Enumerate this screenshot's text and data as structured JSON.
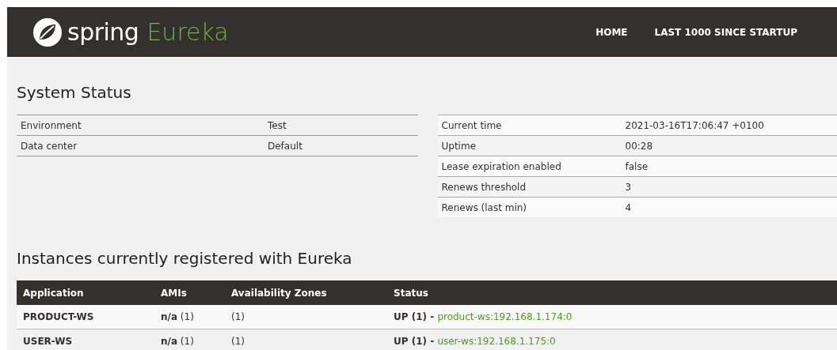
{
  "header": {
    "logo": {
      "brand": "spring",
      "product": "Eureka"
    },
    "nav": [
      "HOME",
      "LAST 1000 SINCE STARTUP"
    ]
  },
  "system_status": {
    "title": "System Status",
    "left_table": [
      {
        "label": "Environment",
        "value": "Test"
      },
      {
        "label": "Data center",
        "value": "Default"
      }
    ],
    "right_table": [
      {
        "label": "Current time",
        "value": "2021-03-16T17:06:47 +0100"
      },
      {
        "label": "Uptime",
        "value": "00:28"
      },
      {
        "label": "Lease expiration enabled",
        "value": "false"
      },
      {
        "label": "Renews threshold",
        "value": "3"
      },
      {
        "label": "Renews (last min)",
        "value": "4"
      }
    ]
  },
  "instances": {
    "title": "Instances currently registered with Eureka",
    "columns": [
      "Application",
      "AMIs",
      "Availability Zones",
      "Status"
    ],
    "rows": [
      {
        "application": "PRODUCT-WS",
        "amis": "**n/a** (1)",
        "zones": "(1)",
        "status": "UP (1) - ",
        "instance_link": "product-ws:192.168.1.174:0"
      },
      {
        "application": "USER-WS",
        "amis": "**n/a** (1)",
        "zones": "(1)",
        "status": "UP (1) - ",
        "instance_link": "user-ws:192.168.1.175:0"
      }
    ]
  }
}
